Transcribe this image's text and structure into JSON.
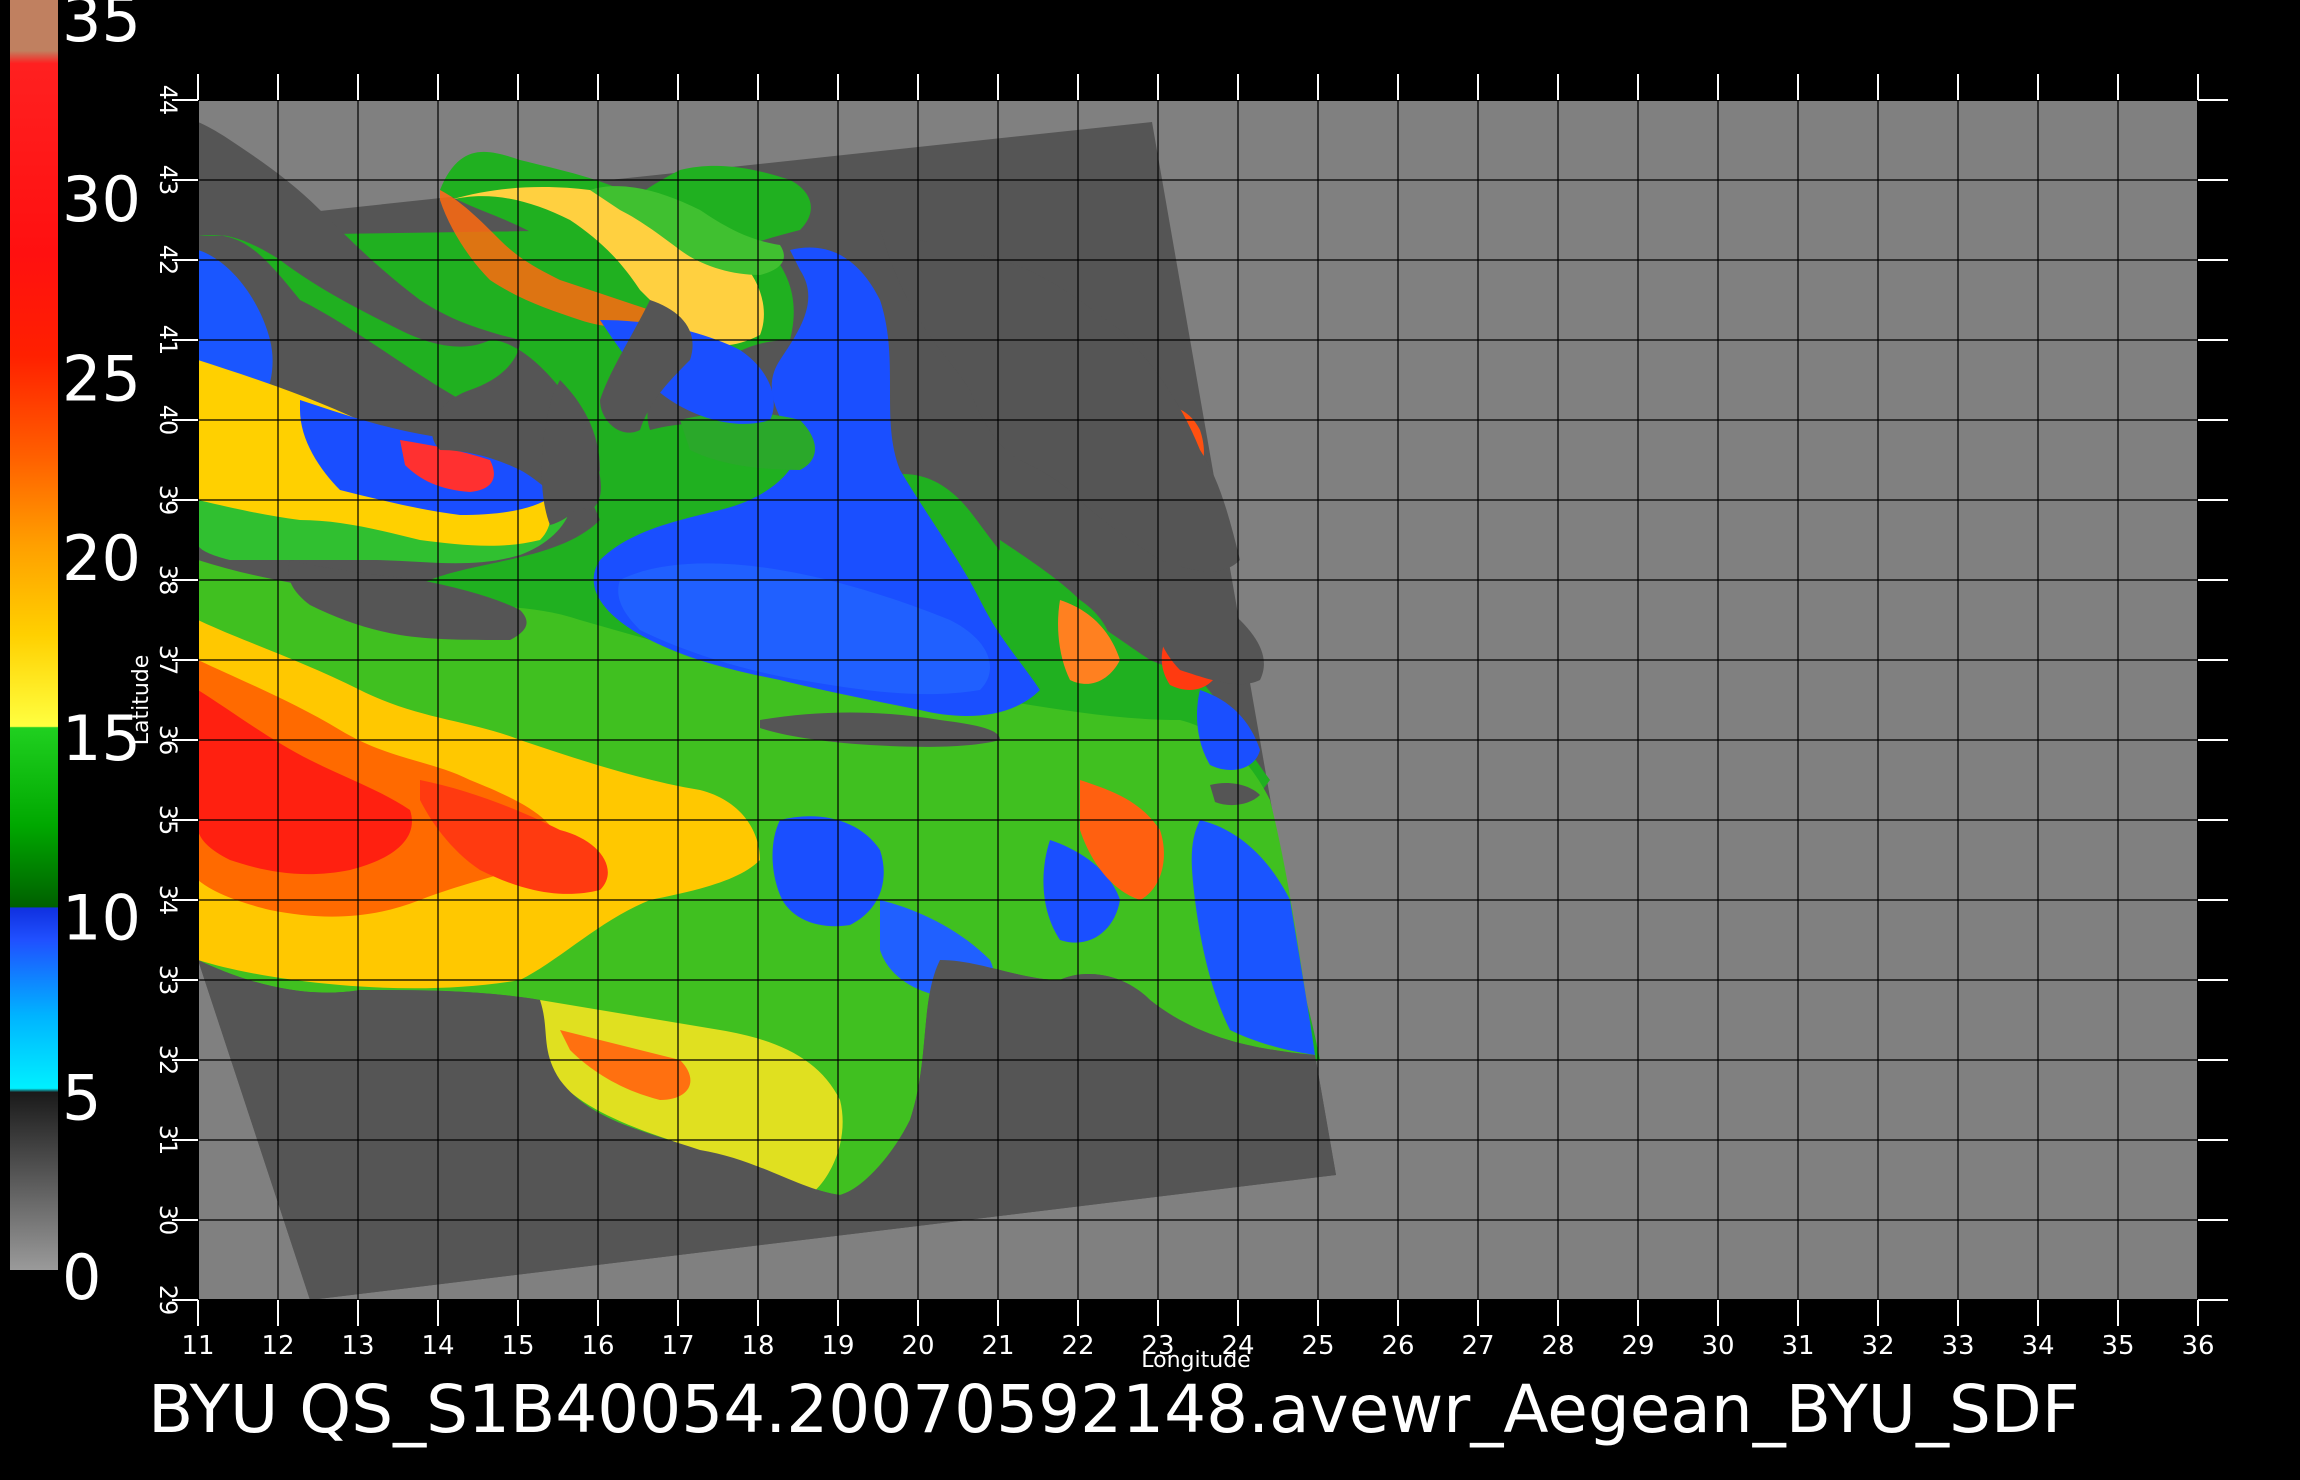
{
  "chart_data": {
    "type": "heatmap",
    "xlabel": "Longitude",
    "ylabel": "Latitude",
    "xlim": [
      11,
      36
    ],
    "ylim": [
      29,
      44
    ],
    "xticks": [
      "11",
      "12",
      "13",
      "14",
      "15",
      "16",
      "17",
      "18",
      "19",
      "20",
      "21",
      "22",
      "23",
      "24",
      "25",
      "26",
      "27",
      "28",
      "29",
      "30",
      "31",
      "32",
      "33",
      "34",
      "35",
      "36"
    ],
    "yticks": [
      "29",
      "30",
      "31",
      "32",
      "33",
      "34",
      "35",
      "36",
      "37",
      "38",
      "39",
      "40",
      "41",
      "42",
      "43",
      "44"
    ],
    "colorbar": {
      "labels": [
        "35",
        "30",
        "25",
        "20",
        "15",
        "10",
        "5",
        "0"
      ],
      "values": [
        35,
        30,
        25,
        20,
        15,
        10,
        5,
        0
      ]
    },
    "footer": "BYU  QS_S1B40054.20070592148.avewr_Aegean_BYU_SDF"
  },
  "colors": {
    "background": "#000000",
    "land_mask": "#808080",
    "swath": "#555555",
    "grid": "#000000"
  }
}
